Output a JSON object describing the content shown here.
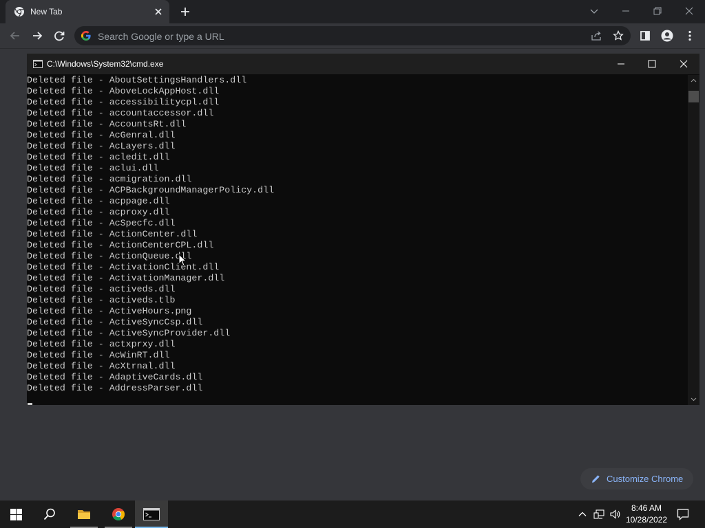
{
  "browser": {
    "tab_title": "New Tab",
    "omnibox_placeholder": "Search Google or type a URL",
    "customize_label": "Customize Chrome"
  },
  "cmd": {
    "window_title": "C:\\Windows\\System32\\cmd.exe",
    "lines": [
      "Deleted file - AboutSettingsHandlers.dll",
      "Deleted file - AboveLockAppHost.dll",
      "Deleted file - accessibilitycpl.dll",
      "Deleted file - accountaccessor.dll",
      "Deleted file - AccountsRt.dll",
      "Deleted file - AcGenral.dll",
      "Deleted file - AcLayers.dll",
      "Deleted file - acledit.dll",
      "Deleted file - aclui.dll",
      "Deleted file - acmigration.dll",
      "Deleted file - ACPBackgroundManagerPolicy.dll",
      "Deleted file - acppage.dll",
      "Deleted file - acproxy.dll",
      "Deleted file - AcSpecfc.dll",
      "Deleted file - ActionCenter.dll",
      "Deleted file - ActionCenterCPL.dll",
      "Deleted file - ActionQueue.dll",
      "Deleted file - ActivationClient.dll",
      "Deleted file - ActivationManager.dll",
      "Deleted file - activeds.dll",
      "Deleted file - activeds.tlb",
      "Deleted file - ActiveHours.png",
      "Deleted file - ActiveSyncCsp.dll",
      "Deleted file - ActiveSyncProvider.dll",
      "Deleted file - actxprxy.dll",
      "Deleted file - AcWinRT.dll",
      "Deleted file - AcXtrnal.dll",
      "Deleted file - AdaptiveCards.dll",
      "Deleted file - AddressParser.dll"
    ]
  },
  "taskbar": {
    "time": "8:46 AM",
    "date": "10/28/2022"
  },
  "colors": {
    "chrome_dark": "#202124",
    "chrome_toolbar": "#35363a",
    "accent_blue": "#8ab4f8",
    "console_bg": "#0c0c0c",
    "console_text": "#cccccc",
    "taskbar_bg": "#1c1c1c",
    "taskbar_active": "#76b9ed"
  },
  "icons": {
    "tab_favicon": "chrome-logo-icon",
    "tab_close": "close-icon",
    "new_tab": "plus-icon",
    "tab_search": "chevron-down-icon",
    "back": "arrow-left-icon",
    "forward": "arrow-right-icon",
    "reload": "reload-icon",
    "omnibox": "google-g-icon",
    "share": "share-icon",
    "bookmark": "star-icon",
    "side_panel": "side-panel-icon",
    "profile": "profile-icon",
    "menu": "kebab-menu-icon",
    "cmd": "console-icon",
    "customize": "pencil-icon",
    "start": "windows-logo-icon",
    "search": "search-icon",
    "explorer": "folder-icon",
    "chrome_taskbar": "chrome-logo-icon",
    "terminal_taskbar": "console-icon",
    "tray_chevron": "chevron-up-icon",
    "network": "network-icon",
    "volume": "volume-icon",
    "notifications": "notification-icon"
  }
}
